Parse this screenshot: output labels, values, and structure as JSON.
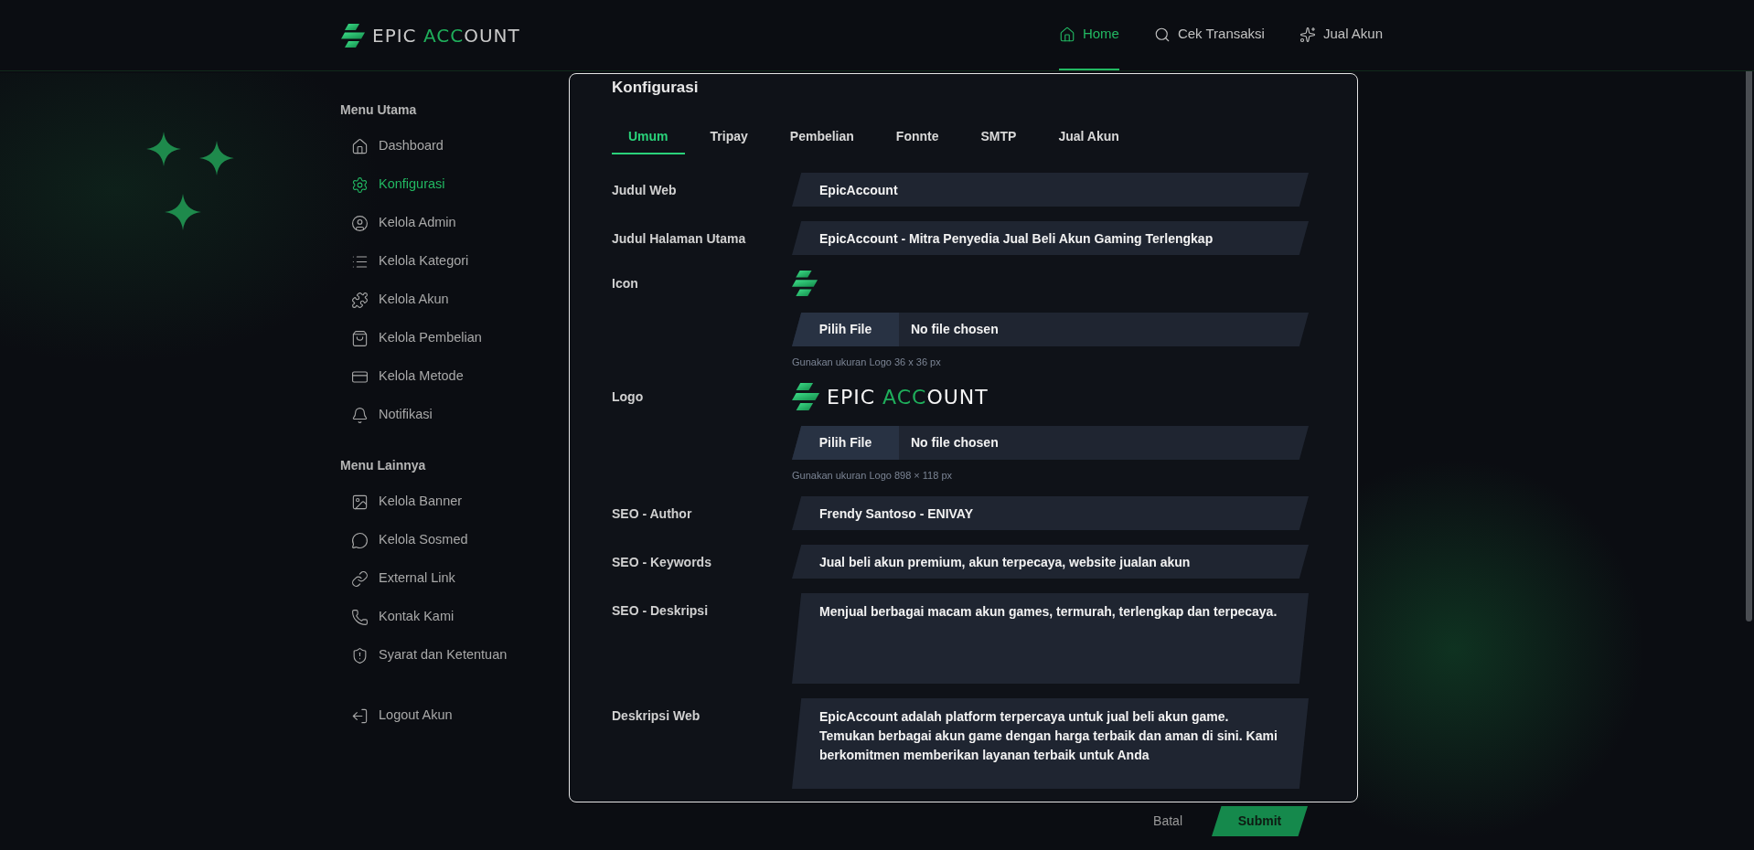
{
  "header": {
    "logo": [
      "EPIC ",
      "ACC",
      "OUNT"
    ],
    "nav": [
      {
        "label": "Home",
        "selected": true
      },
      {
        "label": "Cek Transaksi",
        "selected": false
      },
      {
        "label": "Jual Akun",
        "selected": false
      }
    ]
  },
  "sidebar": {
    "sections": [
      {
        "title": "Menu Utama",
        "items": [
          {
            "label": "Dashboard",
            "selected": false
          },
          {
            "label": "Konfigurasi",
            "selected": true
          },
          {
            "label": "Kelola Admin",
            "selected": false
          },
          {
            "label": "Kelola Kategori",
            "selected": false
          },
          {
            "label": "Kelola Akun",
            "selected": false
          },
          {
            "label": "Kelola Pembelian",
            "selected": false
          },
          {
            "label": "Kelola Metode",
            "selected": false
          },
          {
            "label": "Notifikasi",
            "selected": false
          }
        ]
      },
      {
        "title": "Menu Lainnya",
        "items": [
          {
            "label": "Kelola Banner",
            "selected": false
          },
          {
            "label": "Kelola Sosmed",
            "selected": false
          },
          {
            "label": "External Link",
            "selected": false
          },
          {
            "label": "Kontak Kami",
            "selected": false
          },
          {
            "label": "Syarat dan Ketentuan",
            "selected": false
          }
        ]
      }
    ],
    "logout": "Logout Akun"
  },
  "card": {
    "title": "Konfigurasi",
    "tabs": [
      {
        "label": "Umum",
        "selected": true
      },
      {
        "label": "Tripay",
        "selected": false
      },
      {
        "label": "Pembelian",
        "selected": false
      },
      {
        "label": "Fonnte",
        "selected": false
      },
      {
        "label": "SMTP",
        "selected": false
      },
      {
        "label": "Jual Akun",
        "selected": false
      }
    ],
    "rows": [
      {
        "kind": "text",
        "label": "Judul Web",
        "value": "EpicAccount"
      },
      {
        "kind": "text",
        "label": "Judul Halaman Utama",
        "value": "EpicAccount - Mitra Penyedia Jual Beli Akun Gaming Terlengkap"
      },
      {
        "kind": "icon",
        "label": "Icon",
        "button": "Pilih File",
        "file_status": "No file chosen",
        "hint": "Gunakan ukuran Logo 36 x 36 px"
      },
      {
        "kind": "logo",
        "label": "Logo",
        "preview": [
          "EPIC ",
          "ACC",
          "OUNT"
        ],
        "button": "Pilih File",
        "file_status": "No file chosen",
        "hint": "Gunakan ukuran Logo 898 × 118 px"
      },
      {
        "kind": "text",
        "label": "SEO - Author",
        "value": "Frendy Santoso - ENIVAY"
      },
      {
        "kind": "text",
        "label": "SEO - Keywords",
        "value": "Jual beli akun premium, akun terpecaya, website jualan akun"
      },
      {
        "kind": "textarea",
        "label": "SEO - Deskripsi",
        "value": "Menjual berbagai macam akun games, termurah, terlengkap dan terpecaya."
      },
      {
        "kind": "textarea",
        "label": "Deskripsi Web",
        "value": "EpicAccount adalah platform terpercaya untuk jual beli akun game. Temukan berbagai akun game dengan harga terbaik dan aman di sini. Kami berkomitmen memberikan layanan terbaik untuk Anda"
      }
    ]
  },
  "actions": {
    "cancel": "Batal",
    "submit": "Submit"
  }
}
